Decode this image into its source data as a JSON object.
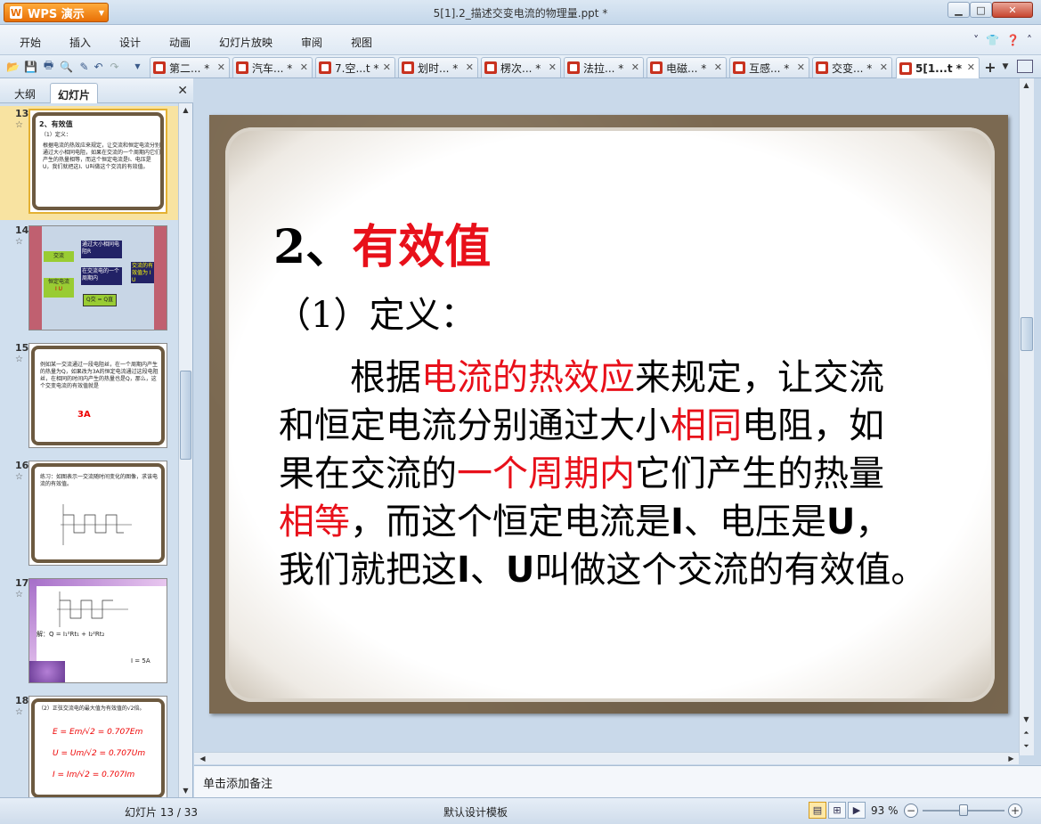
{
  "app": {
    "name": "WPS 演示",
    "logo_letter": "W"
  },
  "window": {
    "title": "5[1].2_描述交变电流的物理量.ppt *"
  },
  "menu": [
    "开始",
    "插入",
    "设计",
    "动画",
    "幻灯片放映",
    "审阅",
    "视图"
  ],
  "doc_tabs": [
    {
      "label": "第二... *"
    },
    {
      "label": "汽车... *"
    },
    {
      "label": "7.空...t *"
    },
    {
      "label": "划时... *"
    },
    {
      "label": "楞次... *"
    },
    {
      "label": "法拉... *"
    },
    {
      "label": "电磁... *"
    },
    {
      "label": "互感... *"
    },
    {
      "label": "交变... *"
    },
    {
      "label": "5[1...t *",
      "active": true
    }
  ],
  "panel": {
    "tab_outline": "大纲",
    "tab_slides": "幻灯片"
  },
  "thumbnails": [
    {
      "num": "13",
      "selected": true,
      "title": "2、有效值",
      "sub": "（1）定义：",
      "text": "根据电流的热效应来规定，让交流和恒定电流分别通过大小相同电阻，如果在交流的一个周期内它们产生的热量相等，而这个恒定电流是I、电压是U，我们就把这I、U叫做这个交流的有效值。"
    },
    {
      "num": "14",
      "boxes": [
        "交流",
        "恒定电流",
        "I U",
        "通过大小相同电阻R",
        "在交流电的一个周期内",
        "Q交 = Q直",
        "交流的有效值为 I U"
      ]
    },
    {
      "num": "15",
      "text": "例如某一交流通过一段电阻丝，在一个周期内产生的热量为Q，如果改为3A的恒定电流通过这段电阻丝，在相同的时间内产生的热量也是Q，那么，这个交变电流的有效值就是",
      "answer": "3A"
    },
    {
      "num": "16",
      "text": "练习：如图表示一交流随时间变化的图像，求该电流的有效值。"
    },
    {
      "num": "17",
      "text": "解：Q = I₁²Rt₁ + I₂²Rt₂",
      "eq": "I = 5A"
    },
    {
      "num": "18",
      "text": "（2）正弦交流电的最大值为有效值的√2倍。",
      "eqs": [
        "E = Em/√2 = 0.707Em",
        "U = Um/√2 = 0.707Um",
        "I = Im/√2 = 0.707Im"
      ]
    }
  ],
  "slide": {
    "heading_num": "2、",
    "heading_red": "有效值",
    "subheading": "（1）定义：",
    "body": [
      [
        {
          "t": "　　根据"
        },
        {
          "t": "电流的热效应",
          "red": true
        },
        {
          "t": "来规定，让交流"
        }
      ],
      [
        {
          "t": "和恒定电流分别通过大小"
        },
        {
          "t": "相同",
          "red": true
        },
        {
          "t": "电阻，如"
        }
      ],
      [
        {
          "t": "果在交流的"
        },
        {
          "t": "一个周期内",
          "red": true
        },
        {
          "t": "它们产生的热量"
        }
      ],
      [
        {
          "t": "相等",
          "red": true
        },
        {
          "t": "，而这个恒定电流是"
        },
        {
          "t": "I",
          "bold": true
        },
        {
          "t": "、电压是"
        },
        {
          "t": "U",
          "bold": true
        },
        {
          "t": "，"
        }
      ],
      [
        {
          "t": "我们就把这"
        },
        {
          "t": "I",
          "bold": true
        },
        {
          "t": "、"
        },
        {
          "t": "U",
          "bold": true
        },
        {
          "t": "叫做这个交流的有效值。"
        }
      ]
    ]
  },
  "notes_placeholder": "单击添加备注",
  "status": {
    "slide_info": "幻灯片 13 / 33",
    "template": "默认设计模板",
    "zoom": "93 %",
    "zoom_level": 0.5
  },
  "colors": {
    "accent_red": "#e8101a",
    "wps_orange": "#e86f06",
    "selected_thumb": "#f8e3a1"
  }
}
